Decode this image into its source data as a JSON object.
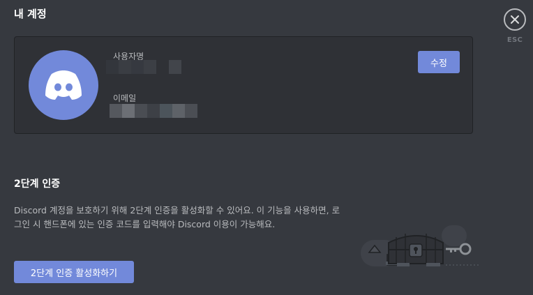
{
  "page": {
    "title": "내 계정"
  },
  "close": {
    "icon": "close-icon",
    "esc_label": "ESC"
  },
  "account": {
    "avatar_icon": "discord-logo-icon",
    "avatar_color": "#7289da",
    "username_label": "사용자명",
    "email_label": "이메일",
    "edit_label": "수정"
  },
  "two_factor": {
    "title": "2단계 인증",
    "description": "Discord 계정을 보호하기 위해 2단계 인증을 활성화할 수 있어요. 이 기능을 사용하면, 로그인 시 핸드폰에 있는 인증 코드를 입력해야 Discord 이용이 가능해요.",
    "enable_label": "2단계 인증 활성화하기",
    "illustration_icon": "treasure-chest-key-illustration"
  },
  "colors": {
    "background": "#36393f",
    "card": "#2f3136",
    "accent": "#7289da"
  }
}
